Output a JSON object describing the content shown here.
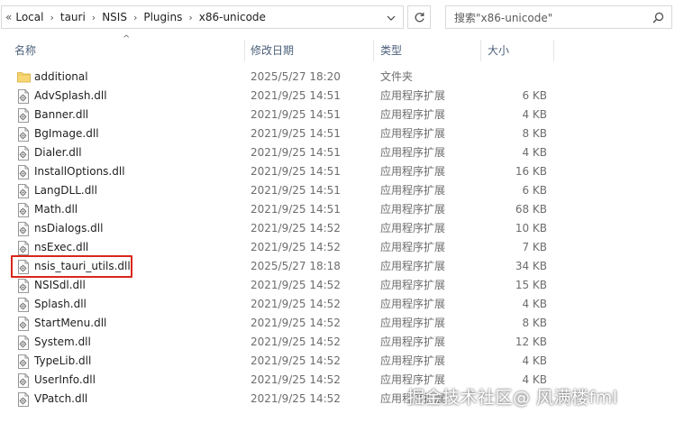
{
  "address_bar": {
    "overflow_label": "«",
    "segments": [
      "Local",
      "tauri",
      "NSIS",
      "Plugins",
      "x86-unicode"
    ],
    "separator": "›"
  },
  "search": {
    "placeholder": "搜索\"x86-unicode\""
  },
  "columns": {
    "name": "名称",
    "date": "修改日期",
    "type": "类型",
    "size": "大小",
    "sort_indicator": "^"
  },
  "files": [
    {
      "name": "additional",
      "date": "2025/5/27 18:20",
      "type": "文件夹",
      "size": "",
      "icon": "folder-icon"
    },
    {
      "name": "AdvSplash.dll",
      "date": "2021/9/25 14:51",
      "type": "应用程序扩展",
      "size": "6 KB",
      "icon": "dll-file-icon"
    },
    {
      "name": "Banner.dll",
      "date": "2021/9/25 14:51",
      "type": "应用程序扩展",
      "size": "4 KB",
      "icon": "dll-file-icon"
    },
    {
      "name": "BgImage.dll",
      "date": "2021/9/25 14:51",
      "type": "应用程序扩展",
      "size": "8 KB",
      "icon": "dll-file-icon"
    },
    {
      "name": "Dialer.dll",
      "date": "2021/9/25 14:51",
      "type": "应用程序扩展",
      "size": "4 KB",
      "icon": "dll-file-icon"
    },
    {
      "name": "InstallOptions.dll",
      "date": "2021/9/25 14:51",
      "type": "应用程序扩展",
      "size": "16 KB",
      "icon": "dll-file-icon"
    },
    {
      "name": "LangDLL.dll",
      "date": "2021/9/25 14:51",
      "type": "应用程序扩展",
      "size": "6 KB",
      "icon": "dll-file-icon"
    },
    {
      "name": "Math.dll",
      "date": "2021/9/25 14:51",
      "type": "应用程序扩展",
      "size": "68 KB",
      "icon": "dll-file-icon"
    },
    {
      "name": "nsDialogs.dll",
      "date": "2021/9/25 14:52",
      "type": "应用程序扩展",
      "size": "10 KB",
      "icon": "dll-file-icon"
    },
    {
      "name": "nsExec.dll",
      "date": "2021/9/25 14:52",
      "type": "应用程序扩展",
      "size": "7 KB",
      "icon": "dll-file-icon"
    },
    {
      "name": "nsis_tauri_utils.dll",
      "date": "2025/5/27 18:18",
      "type": "应用程序扩展",
      "size": "34 KB",
      "icon": "dll-file-icon"
    },
    {
      "name": "NSISdl.dll",
      "date": "2021/9/25 14:52",
      "type": "应用程序扩展",
      "size": "15 KB",
      "icon": "dll-file-icon"
    },
    {
      "name": "Splash.dll",
      "date": "2021/9/25 14:52",
      "type": "应用程序扩展",
      "size": "4 KB",
      "icon": "dll-file-icon"
    },
    {
      "name": "StartMenu.dll",
      "date": "2021/9/25 14:52",
      "type": "应用程序扩展",
      "size": "8 KB",
      "icon": "dll-file-icon"
    },
    {
      "name": "System.dll",
      "date": "2021/9/25 14:52",
      "type": "应用程序扩展",
      "size": "12 KB",
      "icon": "dll-file-icon"
    },
    {
      "name": "TypeLib.dll",
      "date": "2021/9/25 14:52",
      "type": "应用程序扩展",
      "size": "4 KB",
      "icon": "dll-file-icon"
    },
    {
      "name": "UserInfo.dll",
      "date": "2021/9/25 14:52",
      "type": "应用程序扩展",
      "size": "4 KB",
      "icon": "dll-file-icon"
    },
    {
      "name": "VPatch.dll",
      "date": "2021/9/25 14:52",
      "type": "应用程序扩展",
      "size": "",
      "icon": "dll-file-icon"
    }
  ],
  "highlight": {
    "color": "#d9261c"
  },
  "watermark": {
    "text": "掘金技术社区@ 风满楼fml"
  }
}
